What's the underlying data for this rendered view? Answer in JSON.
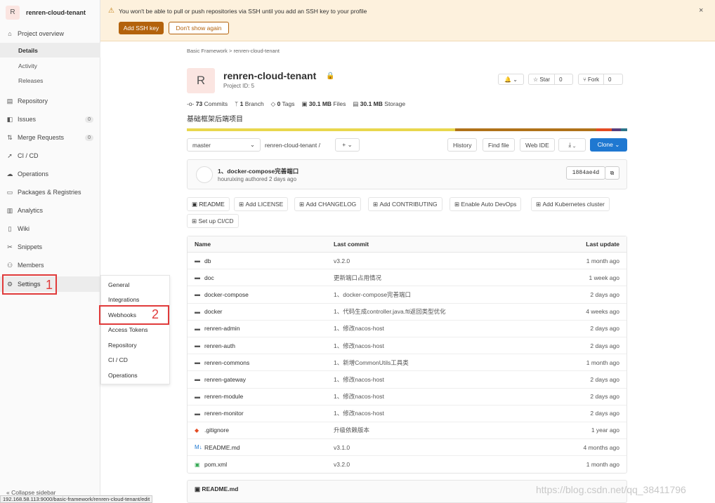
{
  "project": {
    "avatar_letter": "R",
    "name": "renren-cloud-tenant",
    "id_label": "Project ID: 5",
    "description": "基础框架后端项目"
  },
  "sidebar": {
    "project_overview": "Project overview",
    "sub": [
      "Details",
      "Activity",
      "Releases"
    ],
    "items": [
      {
        "label": "Repository",
        "icon": "book-icon"
      },
      {
        "label": "Issues",
        "icon": "issues-icon",
        "count": "0"
      },
      {
        "label": "Merge Requests",
        "icon": "merge-icon",
        "count": "0"
      },
      {
        "label": "CI / CD",
        "icon": "rocket-icon"
      },
      {
        "label": "Operations",
        "icon": "cloud-icon"
      },
      {
        "label": "Packages & Registries",
        "icon": "package-icon"
      },
      {
        "label": "Analytics",
        "icon": "chart-icon"
      },
      {
        "label": "Wiki",
        "icon": "book-icon"
      },
      {
        "label": "Snippets",
        "icon": "scissors-icon"
      },
      {
        "label": "Members",
        "icon": "users-icon"
      },
      {
        "label": "Settings",
        "icon": "gear-icon"
      }
    ],
    "collapse": "Collapse sidebar",
    "annotation_1": "1"
  },
  "flyout": {
    "items": [
      "General",
      "Integrations",
      "Webhooks",
      "Access Tokens",
      "Repository",
      "CI / CD",
      "Operations"
    ],
    "annotation_2": "2"
  },
  "status_url": "192.168.58.113:9000/basic-framework/renren-cloud-tenant/edit",
  "banner": {
    "text": "You won't be able to pull or push repositories via SSH until you add an SSH key to your profile",
    "add_ssh": "Add SSH key",
    "dont_show": "Don't show again",
    "close": "×"
  },
  "breadcrumb": {
    "group": "Basic Framework",
    "sep": ">",
    "project": "renren-cloud-tenant"
  },
  "header_buttons": {
    "notify": "🔔 ⌄",
    "star": "☆ Star",
    "star_count": "0",
    "fork": "⑂ Fork",
    "fork_count": "0"
  },
  "stats": [
    {
      "icon": "commit-icon",
      "value": "73",
      "label": "Commits"
    },
    {
      "icon": "branch-icon",
      "value": "1",
      "label": "Branch"
    },
    {
      "icon": "tag-icon",
      "value": "0",
      "label": "Tags"
    },
    {
      "icon": "file-icon",
      "value": "30.1 MB",
      "label": "Files"
    },
    {
      "icon": "storage-icon",
      "value": "30.1 MB",
      "label": "Storage"
    }
  ],
  "language_colors": [
    "#e9d74d",
    "#b07219",
    "#e44b23",
    "#563d7c",
    "#2b7489"
  ],
  "language_shares": [
    0.61,
    0.32,
    0.035,
    0.02,
    0.015
  ],
  "controls": {
    "branch": "master",
    "path": "renren-cloud-tenant",
    "slash": "/",
    "add": "+ ⌄",
    "history": "History",
    "find_file": "Find file",
    "web_ide": "Web IDE",
    "download": "⤓ ⌄",
    "clone": "Clone ⌄"
  },
  "last_commit": {
    "title": "1、docker-compose完善端口",
    "author": "houruixing authored 2 days ago",
    "sha": "1884ae4d"
  },
  "quick_buttons": [
    "README",
    "Add LICENSE",
    "Add CHANGELOG",
    "Add CONTRIBUTING",
    "Enable Auto DevOps",
    "Add Kubernetes cluster",
    "Set up CI/CD"
  ],
  "file_table": {
    "headers": {
      "name": "Name",
      "commit": "Last commit",
      "update": "Last update"
    },
    "rows": [
      {
        "name": "db",
        "type": "folder",
        "commit": "v3.2.0",
        "update": "1 month ago"
      },
      {
        "name": "doc",
        "type": "folder",
        "commit": "更新端口占用情况",
        "update": "1 week ago"
      },
      {
        "name": "docker-compose",
        "type": "folder",
        "commit": "1、docker-compose完善端口",
        "update": "2 days ago"
      },
      {
        "name": "docker",
        "type": "folder",
        "commit": "1、代码生成controller.java.ftl返回类型优化",
        "update": "4 weeks ago"
      },
      {
        "name": "renren-admin",
        "type": "folder",
        "commit": "1、修改nacos-host",
        "update": "2 days ago"
      },
      {
        "name": "renren-auth",
        "type": "folder",
        "commit": "1、修改nacos-host",
        "update": "2 days ago"
      },
      {
        "name": "renren-commons",
        "type": "folder",
        "commit": "1、新增CommonUtils工具类",
        "update": "1 month ago"
      },
      {
        "name": "renren-gateway",
        "type": "folder",
        "commit": "1、修改nacos-host",
        "update": "2 days ago"
      },
      {
        "name": "renren-module",
        "type": "folder",
        "commit": "1、修改nacos-host",
        "update": "2 days ago"
      },
      {
        "name": "renren-monitor",
        "type": "folder",
        "commit": "1、修改nacos-host",
        "update": "2 days ago"
      },
      {
        "name": ".gitignore",
        "type": "git",
        "commit": "升级依赖版本",
        "update": "1 year ago"
      },
      {
        "name": "README.md",
        "type": "md",
        "commit": "v3.1.0",
        "update": "4 months ago"
      },
      {
        "name": "pom.xml",
        "type": "xml",
        "commit": "v3.2.0",
        "update": "1 month ago"
      }
    ]
  },
  "readme_title": "README.md",
  "watermark": "https://blog.csdn.net/qq_38411796"
}
